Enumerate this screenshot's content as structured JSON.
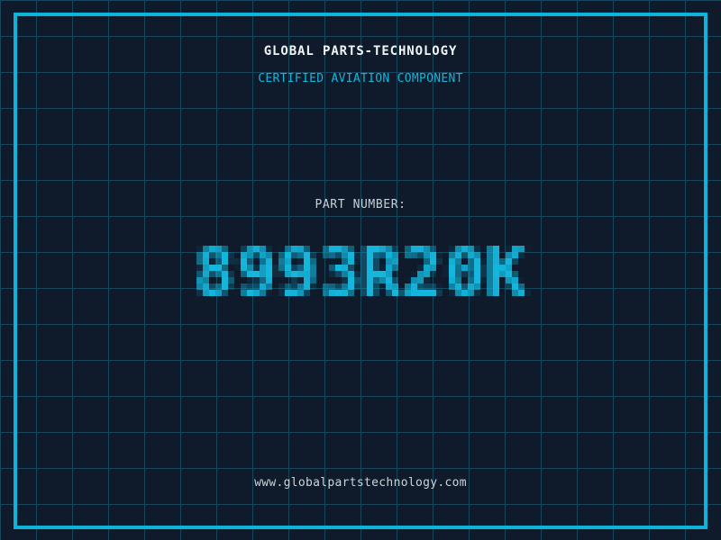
{
  "header": {
    "title": "GLOBAL PARTS-TECHNOLOGY",
    "subtitle": "CERTIFIED AVIATION COMPONENT"
  },
  "part": {
    "label": "PART NUMBER:",
    "number": "8993R20K"
  },
  "footer": {
    "website": "www.globalpartstechnology.com"
  },
  "colors": {
    "background": "#0f1a2b",
    "grid_line": "#17465c",
    "frame_border": "#0db4d9",
    "accent_cyan": "#14b6dc",
    "title_text": "#f2f5f6",
    "label_text": "#c7cfd8",
    "footer_text": "#ccd4da"
  }
}
